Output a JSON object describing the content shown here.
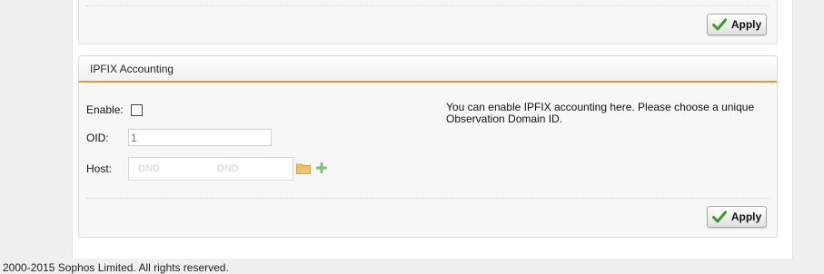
{
  "top_section": {
    "apply_label": "Apply"
  },
  "ipfix": {
    "title": "IPFIX Accounting",
    "enable_label": "Enable:",
    "enable_checked": false,
    "oid_label": "OID:",
    "oid_placeholder": "1",
    "host_label": "Host:",
    "host_dnd_1": "DND",
    "host_dnd_2": "DND",
    "help_text": "You can enable IPFIX accounting here. Please choose a unique Observation Domain ID.",
    "apply_label": "Apply",
    "icons": {
      "folder": "folder-icon",
      "add": "plus-icon",
      "apply": "checkmark-icon"
    }
  },
  "footer": {
    "copyright": "2000-2015 Sophos Limited. All rights reserved."
  },
  "colors": {
    "accent": "#e29a2c",
    "check_green": "#3d9b2b",
    "add_green": "#7cc16a",
    "folder": "#f2c266"
  }
}
